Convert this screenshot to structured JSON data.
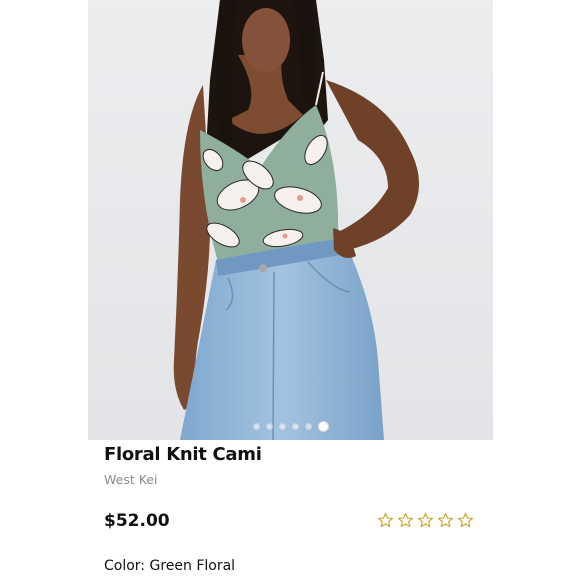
{
  "product": {
    "title": "Floral Knit Cami",
    "brand": "West Kei",
    "price": "$52.00",
    "color_line": "Color: Green Floral"
  },
  "gallery": {
    "image_count": 6,
    "active_index": 5
  },
  "rating": {
    "stars_filled": 0,
    "stars_total": 5
  },
  "colors": {
    "star_outline": "#c9a227",
    "photo_background": "#e7e8ea",
    "top_green": "#8fae9c",
    "denim": "#8eb4d6"
  }
}
